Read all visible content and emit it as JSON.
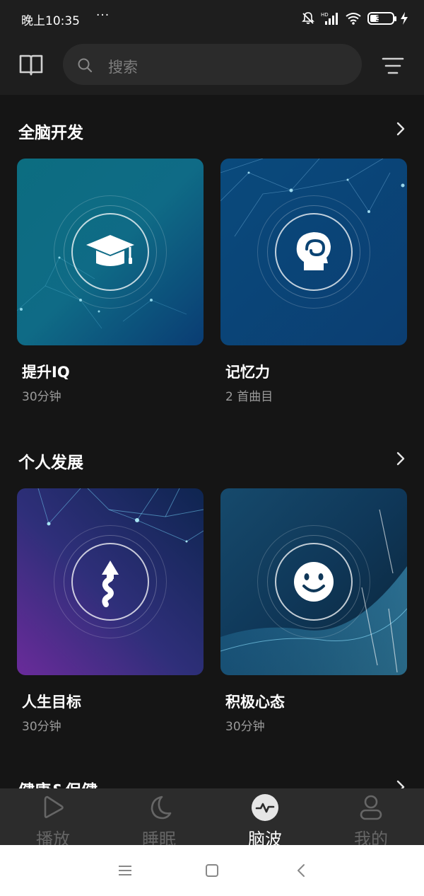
{
  "status_bar": {
    "time": "晚上10:35",
    "dots": "···",
    "battery": "39",
    "icons": [
      "mute-bell-icon",
      "hd-signal-icon",
      "wifi-icon",
      "battery-icon",
      "charging-icon"
    ]
  },
  "header": {
    "search_placeholder": "搜索",
    "icons": [
      "book-icon",
      "search-icon",
      "filter-menu-icon"
    ]
  },
  "sections": [
    {
      "title": "全脑开发",
      "cards": [
        {
          "title": "提升IQ",
          "subtitle": "30分钟",
          "icon": "graduation-cap-icon"
        },
        {
          "title": "记忆力",
          "subtitle": "2 首曲目",
          "icon": "head-brain-icon"
        }
      ]
    },
    {
      "title": "个人发展",
      "cards": [
        {
          "title": "人生目标",
          "subtitle": "30分钟",
          "icon": "path-arrow-icon"
        },
        {
          "title": "积极心态",
          "subtitle": "30分钟",
          "icon": "smiley-icon"
        }
      ]
    },
    {
      "title": "健康&保健",
      "cards": []
    }
  ],
  "bottom_nav": {
    "items": [
      {
        "label": "播放",
        "icon": "play-icon"
      },
      {
        "label": "睡眠",
        "icon": "moon-icon"
      },
      {
        "label": "脑波",
        "icon": "brainwave-icon",
        "active": true
      },
      {
        "label": "我的",
        "icon": "user-icon"
      }
    ]
  },
  "colors": {
    "background": "#151515",
    "header": "#1e1e1e",
    "search": "#2b2b2b",
    "nav": "#2c2c2c",
    "inactive_label": "#666666",
    "subtitle": "#9a9a9a"
  }
}
